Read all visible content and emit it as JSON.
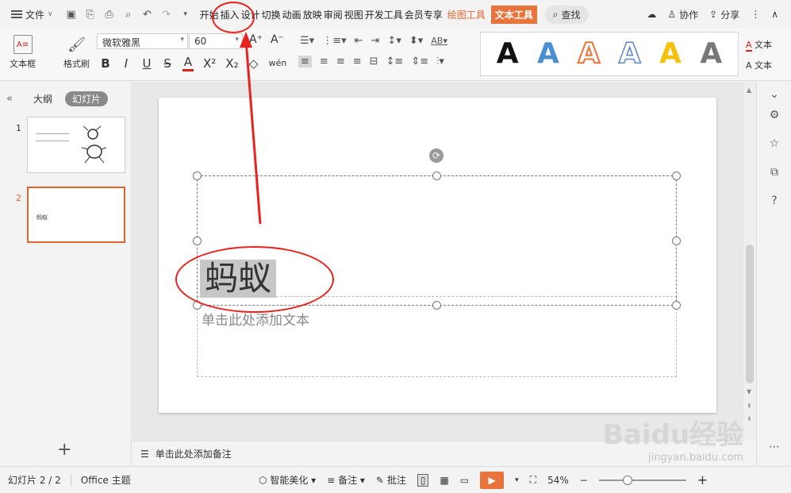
{
  "menubar": {
    "file_label": "文件",
    "tabs": [
      "开始",
      "插入",
      "设计",
      "切换",
      "动画",
      "放映",
      "审阅",
      "视图",
      "开发工具",
      "会员专享"
    ],
    "draw_tools": "绘图工具",
    "text_tools": "文本工具",
    "search_label": "查找",
    "collab_label": "协作",
    "share_label": "分享"
  },
  "ribbon": {
    "textbox_label": "文本框",
    "format_painter_label": "格式刷",
    "font_family": "微软雅黑",
    "font_size": "60",
    "right_labels": [
      "文本",
      "文本"
    ]
  },
  "left_panel": {
    "outline_label": "大纲",
    "slides_label": "幻灯片",
    "thumb_numbers": [
      "1",
      "2"
    ],
    "thumb2_text": "蚂蚁"
  },
  "slide": {
    "title": "蚂蚁",
    "subtitle_placeholder": "单击此处添加文本"
  },
  "notes": {
    "placeholder": "单击此处添加备注"
  },
  "status": {
    "slide_counter": "幻灯片 2 / 2",
    "theme": "Office 主题",
    "smart_beautify": "智能美化",
    "notes_label": "备注",
    "comment_label": "批注",
    "zoom": "54%"
  },
  "watermark": {
    "brand": "Baidu经验",
    "url": "jingyan.baidu.com"
  }
}
